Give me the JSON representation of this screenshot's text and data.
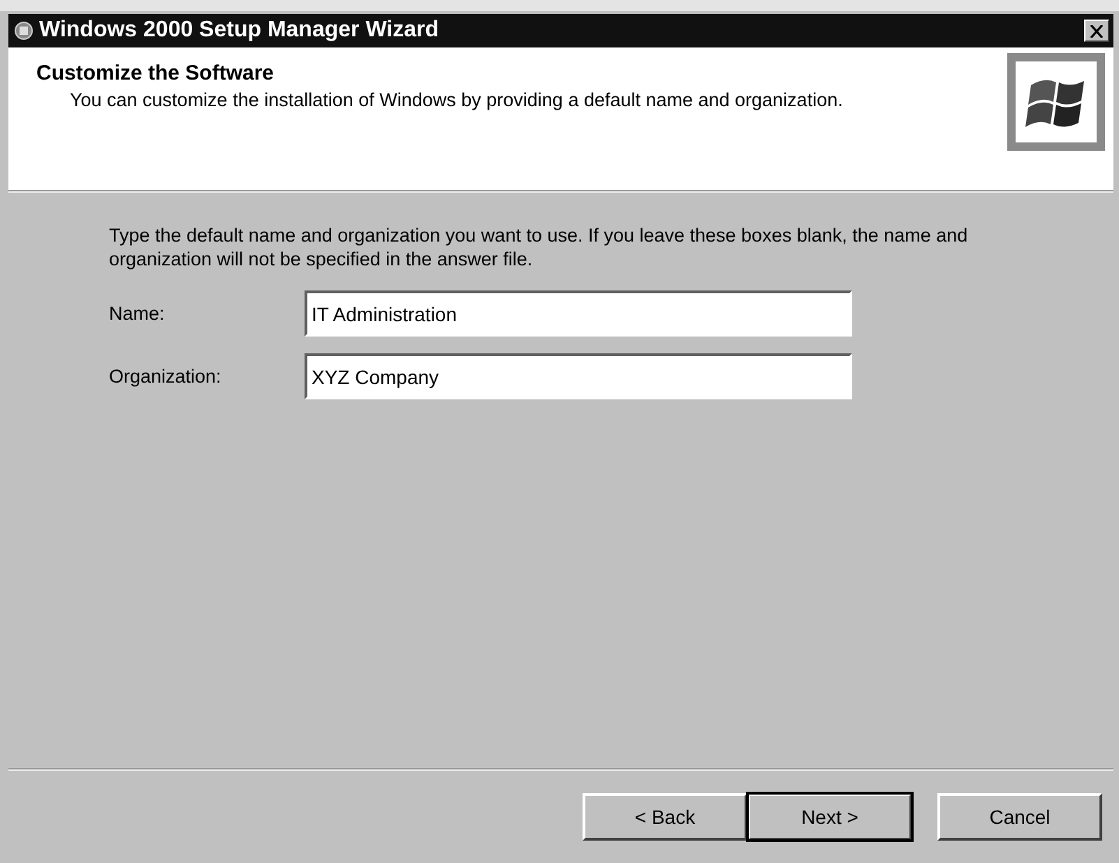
{
  "window": {
    "title": "Windows 2000 Setup Manager Wizard"
  },
  "header": {
    "title": "Customize the Software",
    "subtitle": "You can customize the installation of Windows by providing a default name and organization."
  },
  "instructions": "Type the default name and organization you want to use. If you leave these boxes blank, the name and organization will not be specified in the answer file.",
  "fields": [
    {
      "label": "Name:",
      "value": "IT Administration"
    },
    {
      "label": "Organization:",
      "value": "XYZ Company"
    }
  ],
  "buttons": [
    {
      "label": "< Back",
      "default": false
    },
    {
      "label": "Next >",
      "default": true
    },
    {
      "label": "Cancel",
      "default": false
    }
  ]
}
